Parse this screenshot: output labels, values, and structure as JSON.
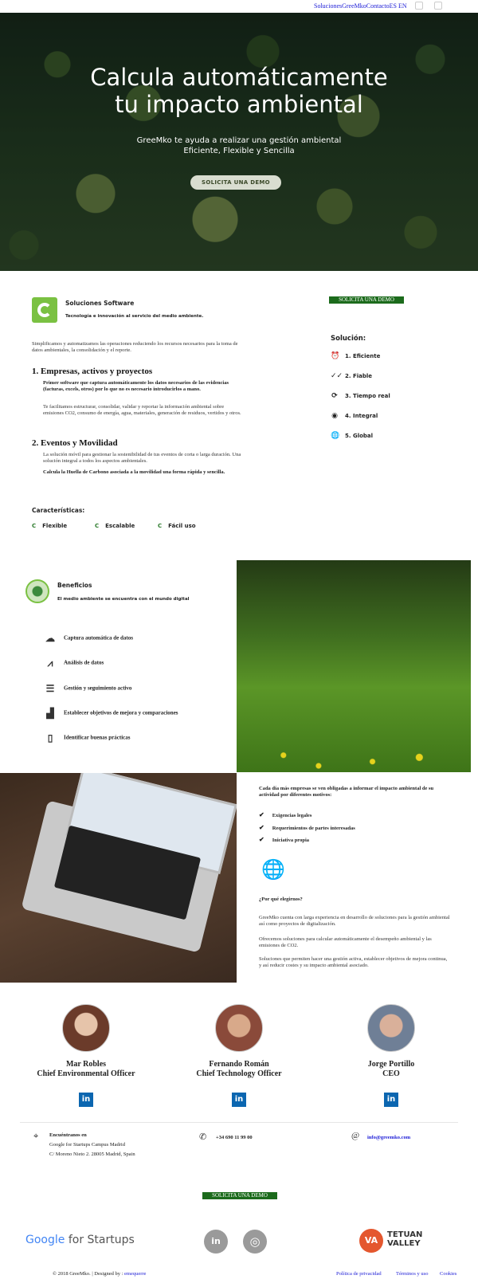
{
  "nav": {
    "links": "SolucionesGreeMkoContactoES",
    "lang_en": "EN"
  },
  "hero": {
    "title_line1": "Calcula automáticamente",
    "title_line2": "tu impacto ambiental",
    "subtitle_line1": "GreeMko te ayuda a realizar una gestión ambiental",
    "subtitle_line2": "Eficiente, Flexible y Sencilla",
    "cta": "SOLICITA UNA DEMO"
  },
  "software": {
    "title": "Soluciones Software",
    "subtitle": "Tecnología e innovación al servicio del medio ambiente.",
    "intro": "Simplificamos y automatizamos las operaciones reduciendo los recursos necesarios para la toma de datos ambientales, la consolidación y el reporte.",
    "section1_title": "1. Empresas, activos y proyectos",
    "section1_bold": "Primer software que captura automáticamente los datos necesarios de las evidencias (facturas, excels, otros) por lo que no es necesario introducirlos a mano.",
    "section1_text": "Te facilitamos estructurar, consolidar, validar y reportar la información ambiental sobre emisiones CO2, consumo de energía, agua, materiales, generación de residuos, vertidos y otros.",
    "section2_title": "2. Eventos y Movilidad",
    "section2_text": "La solución móvil para gestionar la sostenibilidad de tus eventos de corta o larga duración. Una solución integral a todos los aspectos ambientales.",
    "section2_bold": "Calcula la Huella de Carbono asociada a la movilidad una forma rápida y sencilla.",
    "demo_label": "SOLICITA UNA DEMO"
  },
  "solution": {
    "title": "Solución:",
    "items": [
      {
        "label": "1. Eficiente",
        "icon": "alarm-clock-icon",
        "glyph": "⏰"
      },
      {
        "label": "2. Fiable",
        "icon": "double-check-icon",
        "glyph": "✓✓"
      },
      {
        "label": "3. Tiempo real",
        "icon": "sync-icon",
        "glyph": "⟳"
      },
      {
        "label": "4. Integral",
        "icon": "target-icon",
        "glyph": "◉"
      },
      {
        "label": "5. Global",
        "icon": "globe-icon",
        "glyph": "🌐"
      }
    ]
  },
  "features": {
    "title": "Características:",
    "items": [
      "Flexible",
      "Escalable",
      "Fácil uso"
    ],
    "mark": "C"
  },
  "benefits": {
    "title": "Beneficios",
    "subtitle": "El medio ambiente se encuentra con el mundo digital",
    "items": [
      {
        "label": "Captura automática de datos",
        "icon": "cloud-upload-icon",
        "glyph": "☁"
      },
      {
        "label": "Análisis de datos",
        "icon": "chart-icon",
        "glyph": "⩘"
      },
      {
        "label": "Gestión y seguimiento activo",
        "icon": "checklist-icon",
        "glyph": "☰"
      },
      {
        "label": "Establecer objetivos de mejora y comparaciones",
        "icon": "bar-chart-icon",
        "glyph": "▟"
      },
      {
        "label": "Identificar buenas prácticas",
        "icon": "document-icon",
        "glyph": "▯"
      }
    ]
  },
  "why": {
    "intro": "Cada día más empresas se ven obligadas a informar el impacto ambiental de su actividad por diferentes motivos:",
    "items": [
      "Exigencias legales",
      "Requerimientos de partes interesadas",
      "Iniciativa propia"
    ],
    "question": "¿Por qué elegirnos?",
    "p1": "GreeMko cuenta con larga experiencia en desarrollo de soluciones para la gestión ambiental así como proyectos de digitalización.",
    "p2": "Ofrecemos soluciones para calcular automáticamente el desempeño ambiental y las emisiones de CO2.",
    "p3": "Soluciones que permiten hacer una gestión activa, establecer objetivos de mejora continua, y así reducir costes y su impacto ambiental asociado."
  },
  "team": [
    {
      "name": "Mar Robles",
      "role": "Chief Environmental Officer"
    },
    {
      "name": "Fernando Román",
      "role": "Chief Technology Officer"
    },
    {
      "name": "Jorge Portillo",
      "role": "CEO"
    }
  ],
  "linkedin_glyph": "in",
  "contact": {
    "find_us": "Encuéntranos en",
    "place": "Google for Startups Campus Madrid",
    "address": "C/ Moreno Nieto 2. 28005 Madrid, Spain",
    "phone": "+34 690 11 99 00",
    "email": "info@greemko.com"
  },
  "footer": {
    "demo": "SOLICITA UNA DEMO",
    "google_word": "Google",
    "startups_word": " for Startups",
    "instagram_glyph": "◎",
    "tv_mark": "VA",
    "tv_line1": "TETUAN",
    "tv_line2": "VALLEY",
    "copyright": "© 2018 GreeMko. | Designed by :",
    "designer": "emequerre",
    "privacy": "Política de privacidad",
    "terms": "Términos y uso",
    "cookies": "Cookies"
  }
}
